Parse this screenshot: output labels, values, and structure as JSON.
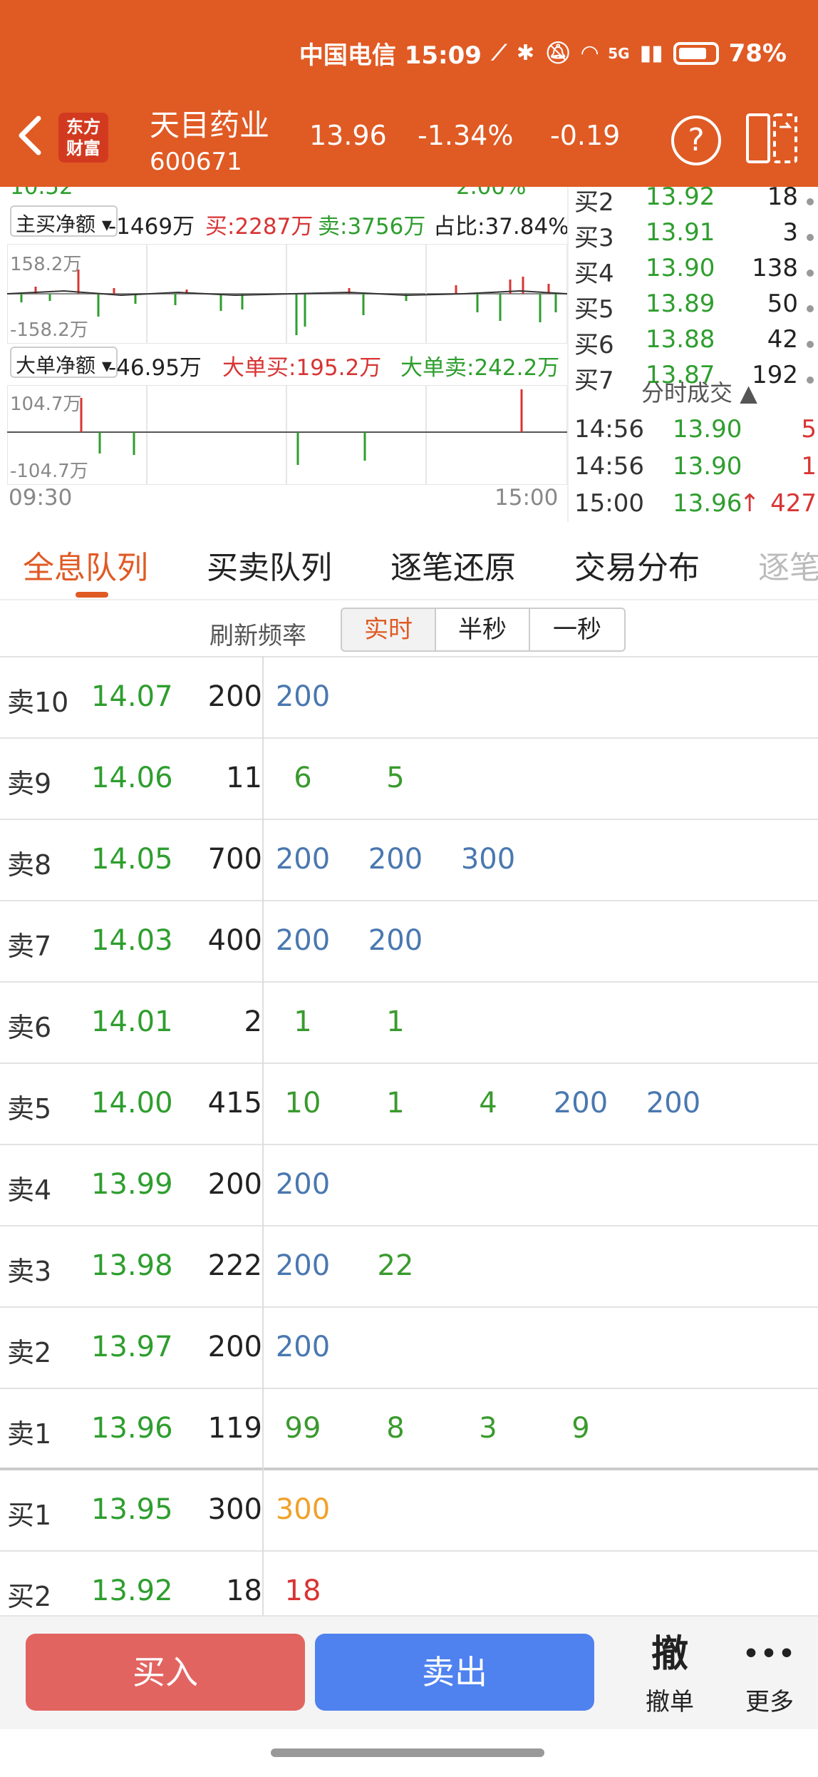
{
  "status_bar": {
    "carrier_time": "中国电信 15:09",
    "signal_label": "5G",
    "battery": "78%"
  },
  "header": {
    "logo_line1": "东方",
    "logo_line2": "财富",
    "stock_name": "天目药业",
    "stock_code": "600671",
    "price": "13.96",
    "change_pct": "-1.34%",
    "change": "-0.19",
    "help_label": "?"
  },
  "chart": {
    "top_partial_left": "10.52",
    "top_partial_right": "2.00%",
    "main_net": {
      "dropdown": "主买净额",
      "value": "-1469万",
      "buy": "买:2287万",
      "sell": "卖:3756万",
      "ratio": "占比:37.84%",
      "axis_top": "158.2万",
      "axis_bottom": "-158.2万"
    },
    "big_net": {
      "dropdown": "大单净额",
      "value": "-46.95万",
      "buy": "大单买:195.2万",
      "sell": "大单卖:242.2万",
      "axis_top": "104.7万",
      "axis_bottom": "-104.7万"
    },
    "time_start": "09:30",
    "time_end": "15:00"
  },
  "right_list": {
    "bids": [
      {
        "label": "买2",
        "price": "13.92",
        "vol": "18"
      },
      {
        "label": "买3",
        "price": "13.91",
        "vol": "3"
      },
      {
        "label": "买4",
        "price": "13.90",
        "vol": "138"
      },
      {
        "label": "买5",
        "price": "13.89",
        "vol": "50"
      },
      {
        "label": "买6",
        "price": "13.88",
        "vol": "42"
      },
      {
        "label": "买7",
        "price": "13.87",
        "vol": "192"
      }
    ],
    "ticks_title": "分时成交",
    "ticks": [
      {
        "time": "14:56",
        "price": "13.90",
        "vol": "5",
        "arrow": ""
      },
      {
        "time": "14:56",
        "price": "13.90",
        "vol": "1",
        "arrow": ""
      },
      {
        "time": "15:00",
        "price": "13.96",
        "vol": "427",
        "arrow": "↑"
      }
    ]
  },
  "tabs": [
    "全息队列",
    "买卖队列",
    "逐笔还原",
    "交易分布",
    "逐笔"
  ],
  "refresh": {
    "label": "刷新频率",
    "options": [
      "实时",
      "半秒",
      "一秒"
    ]
  },
  "queue": [
    {
      "label": "卖10",
      "price": "14.07",
      "vol": "200",
      "cells": [
        {
          "v": "200",
          "c": "blue"
        }
      ]
    },
    {
      "label": "卖9",
      "price": "14.06",
      "vol": "11",
      "cells": [
        {
          "v": "6",
          "c": "green"
        },
        {
          "v": "5",
          "c": "green"
        }
      ]
    },
    {
      "label": "卖8",
      "price": "14.05",
      "vol": "700",
      "cells": [
        {
          "v": "200",
          "c": "blue"
        },
        {
          "v": "200",
          "c": "blue"
        },
        {
          "v": "300",
          "c": "blue"
        }
      ]
    },
    {
      "label": "卖7",
      "price": "14.03",
      "vol": "400",
      "cells": [
        {
          "v": "200",
          "c": "blue"
        },
        {
          "v": "200",
          "c": "blue"
        }
      ]
    },
    {
      "label": "卖6",
      "price": "14.01",
      "vol": "2",
      "cells": [
        {
          "v": "1",
          "c": "green"
        },
        {
          "v": "1",
          "c": "green"
        }
      ]
    },
    {
      "label": "卖5",
      "price": "14.00",
      "vol": "415",
      "cells": [
        {
          "v": "10",
          "c": "green"
        },
        {
          "v": "1",
          "c": "green"
        },
        {
          "v": "4",
          "c": "green"
        },
        {
          "v": "200",
          "c": "blue"
        },
        {
          "v": "200",
          "c": "blue"
        }
      ]
    },
    {
      "label": "卖4",
      "price": "13.99",
      "vol": "200",
      "cells": [
        {
          "v": "200",
          "c": "blue"
        }
      ]
    },
    {
      "label": "卖3",
      "price": "13.98",
      "vol": "222",
      "cells": [
        {
          "v": "200",
          "c": "blue"
        },
        {
          "v": "22",
          "c": "green"
        }
      ]
    },
    {
      "label": "卖2",
      "price": "13.97",
      "vol": "200",
      "cells": [
        {
          "v": "200",
          "c": "blue"
        }
      ]
    },
    {
      "label": "卖1",
      "price": "13.96",
      "vol": "119",
      "cells": [
        {
          "v": "99",
          "c": "green"
        },
        {
          "v": "8",
          "c": "green"
        },
        {
          "v": "3",
          "c": "green"
        },
        {
          "v": "9",
          "c": "green"
        }
      ]
    },
    {
      "label": "买1",
      "price": "13.95",
      "vol": "300",
      "cells": [
        {
          "v": "300",
          "c": "orange"
        }
      ]
    },
    {
      "label": "买2",
      "price": "13.92",
      "vol": "18",
      "cells": [
        {
          "v": "18",
          "c": "red"
        }
      ]
    }
  ],
  "bottom": {
    "buy": "买入",
    "sell": "卖出",
    "cancel_icon": "撤",
    "cancel_label": "撤单",
    "more_icon": "•••",
    "more_label": "更多"
  },
  "colors": {
    "brand": "#E05A24",
    "price_green": "#2E9E2E",
    "buy_button": "#E26461",
    "sell_button": "#4F82EF"
  }
}
